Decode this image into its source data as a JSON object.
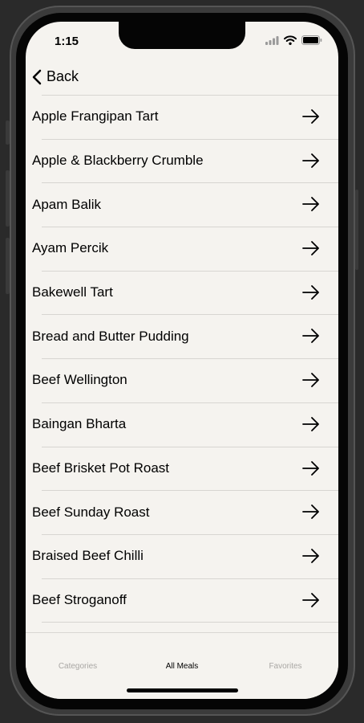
{
  "status_bar": {
    "time": "1:15"
  },
  "nav": {
    "back_label": "Back"
  },
  "meals": [
    "Apple Frangipan Tart",
    "Apple & Blackberry Crumble",
    "Apam Balik",
    "Ayam Percik",
    "Bakewell Tart",
    "Bread and Butter Pudding",
    "Beef Wellington",
    "Baingan Bharta",
    "Beef Brisket Pot Roast",
    "Beef Sunday Roast",
    "Braised Beef Chilli",
    "Beef Stroganoff"
  ],
  "tabs": {
    "categories": "Categories",
    "all_meals": "All Meals",
    "favorites": "Favorites",
    "selected": "All Meals"
  },
  "icons": {
    "back": "chevron-left-icon",
    "row": "arrow-right-icon",
    "signal": "cellular-signal-icon",
    "wifi": "wifi-icon",
    "battery": "battery-icon"
  },
  "colors": {
    "background": "#f5f3ef",
    "separator": "#d7d5d1",
    "tab_inactive": "#a9a7a4",
    "tab_active": "#000000"
  }
}
